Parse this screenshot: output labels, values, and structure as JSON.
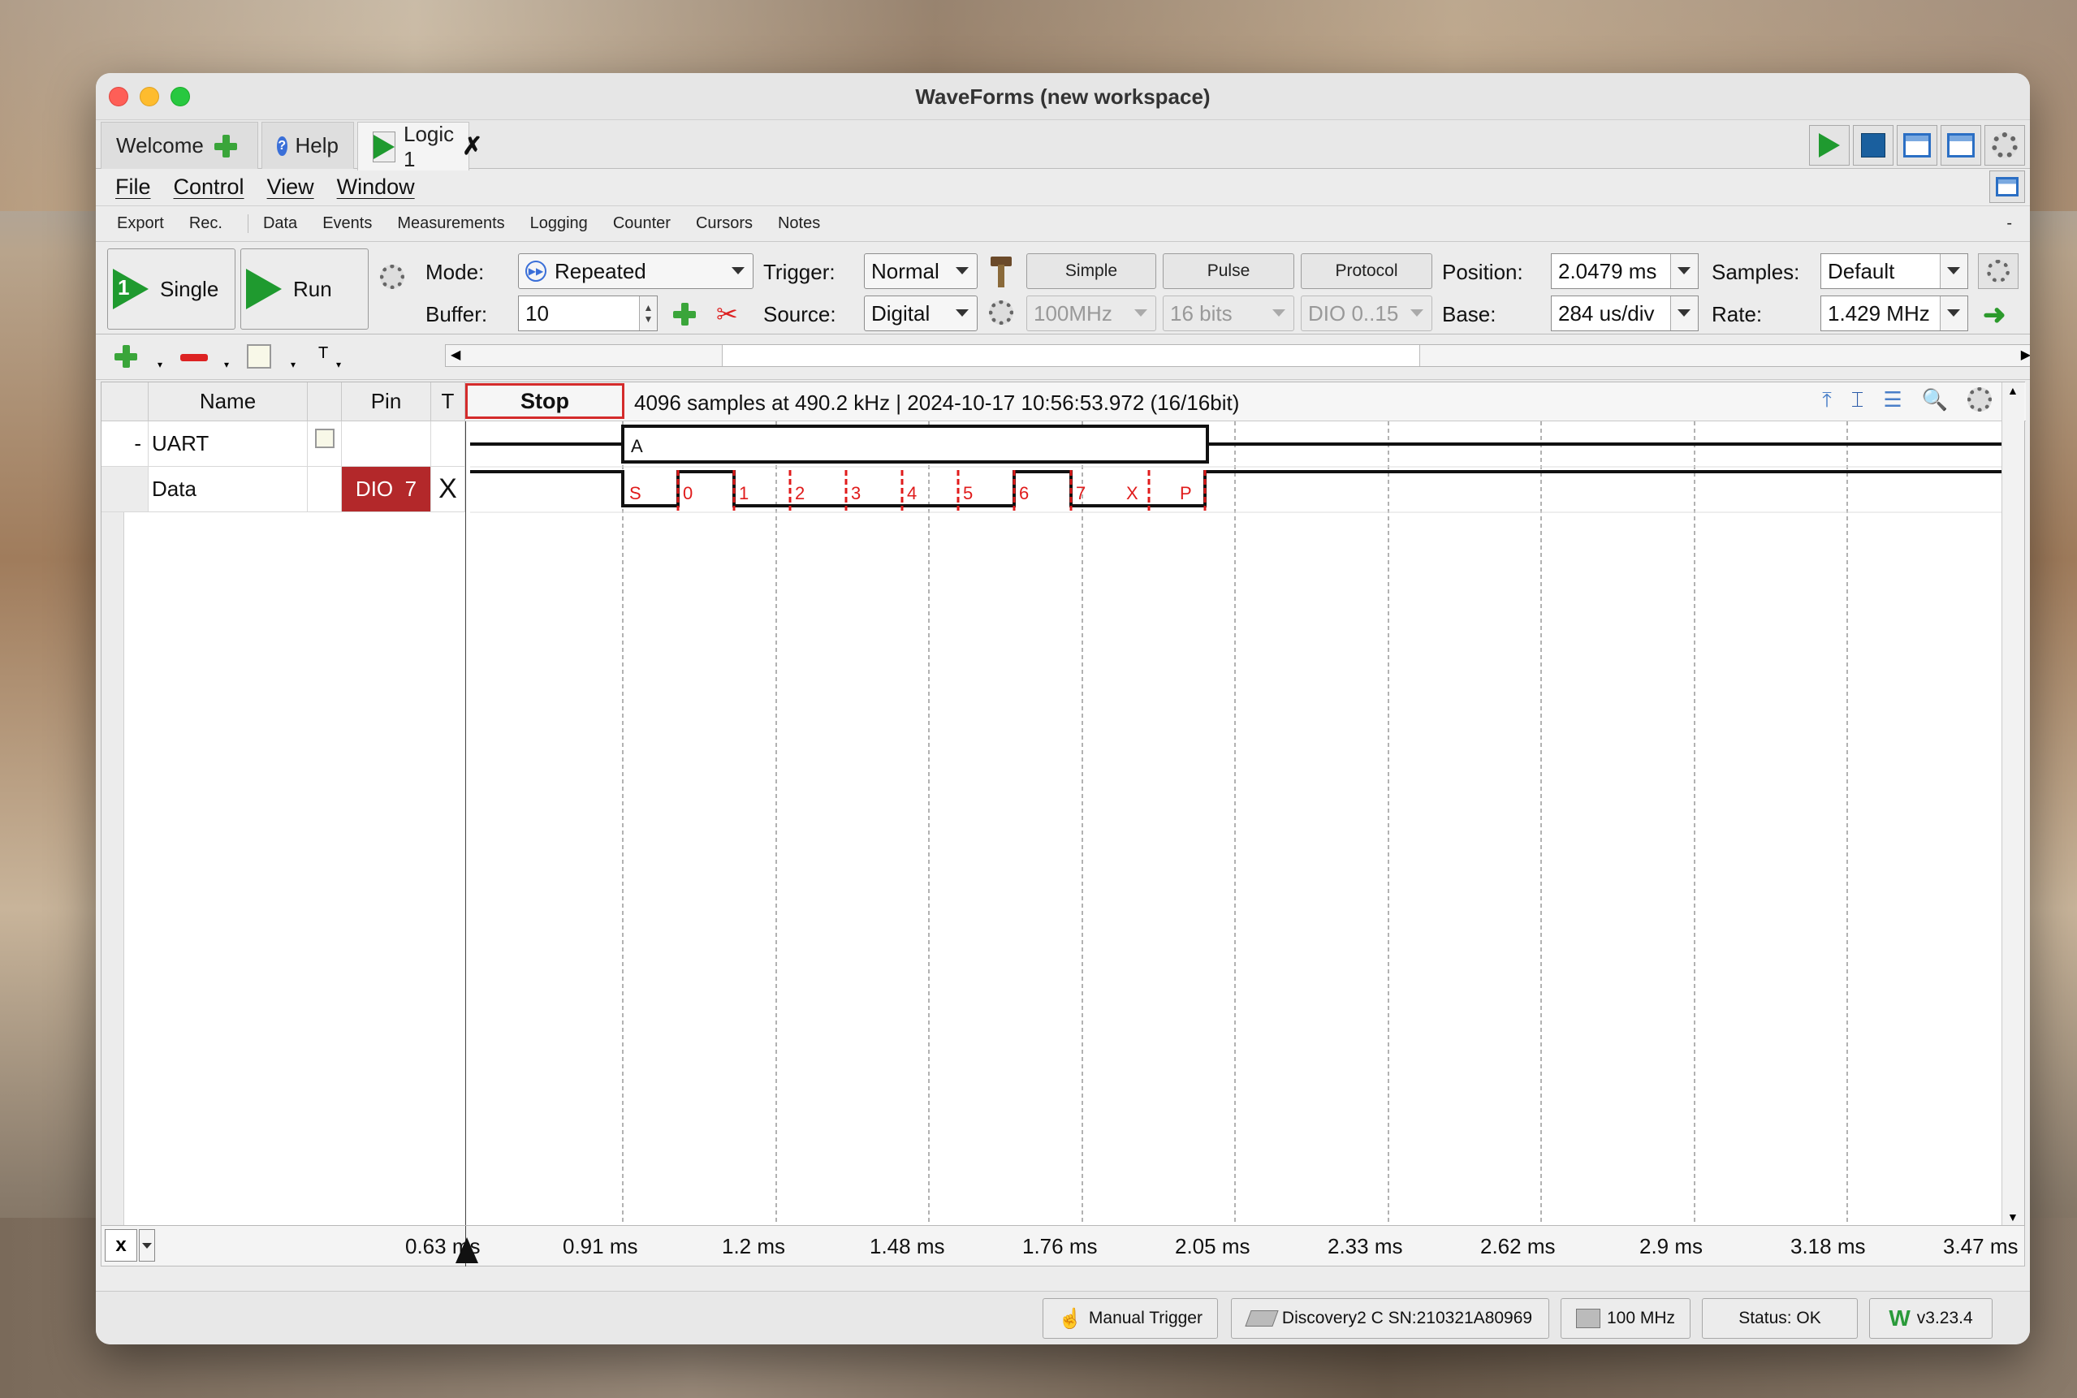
{
  "window": {
    "title": "WaveForms (new workspace)"
  },
  "tabs": [
    {
      "label": "Welcome"
    },
    {
      "label": "Help"
    },
    {
      "label": "Logic 1"
    }
  ],
  "menu": [
    "File",
    "Control",
    "View",
    "Window"
  ],
  "submenu": [
    "Export",
    "Rec.",
    "Data",
    "Events",
    "Measurements",
    "Logging",
    "Counter",
    "Cursors",
    "Notes"
  ],
  "submenu_collapse": "-",
  "controls": {
    "single_label": "Single",
    "single_num": "1",
    "run_label": "Run",
    "mode_label": "Mode:",
    "mode_value": "Repeated",
    "buffer_label": "Buffer:",
    "buffer_value": "10",
    "trigger_label": "Trigger:",
    "trigger_value": "Normal",
    "source_label": "Source:",
    "source_value": "Digital",
    "simple_label": "Simple",
    "pulse_label": "Pulse",
    "protocol_label": "Protocol",
    "freq_value": "100MHz",
    "bits_value": "16 bits",
    "dio_range_value": "DIO 0..15",
    "position_label": "Position:",
    "position_value": "2.0479 ms",
    "base_label": "Base:",
    "base_value": "284 us/div",
    "samples_label": "Samples:",
    "samples_value": "Default",
    "rate_label": "Rate:",
    "rate_value": "1.429 MHz"
  },
  "toolbar2": {
    "t_label": "T"
  },
  "table": {
    "headers": {
      "name": "Name",
      "pin": "Pin",
      "t": "T"
    },
    "stop_label": "Stop",
    "info": "4096 samples at 490.2 kHz | 2024-10-17 10:56:53.972 (16/16bit)",
    "rows": [
      {
        "expander": "-",
        "name": "UART",
        "pin": "",
        "t": ""
      },
      {
        "expander": "",
        "name": "Data",
        "pin": "DIO  7",
        "t": "X"
      }
    ]
  },
  "waveform": {
    "bus_value": "A",
    "bit_labels": [
      "S",
      "0",
      "1",
      "2",
      "3",
      "4",
      "5",
      "6",
      "7",
      "X",
      "P"
    ]
  },
  "time_axis": {
    "x_label": "x",
    "ticks": [
      "0.63 ms",
      "0.91 ms",
      "1.2 ms",
      "1.48 ms",
      "1.76 ms",
      "2.05 ms",
      "2.33 ms",
      "2.62 ms",
      "2.9 ms",
      "3.18 ms",
      "3.47 ms"
    ]
  },
  "status": {
    "manual_trigger": "Manual Trigger",
    "device": "Discovery2 C SN:210321A80969",
    "clock": "100 MHz",
    "status": "Status: OK",
    "version": "v3.23.4"
  },
  "colors": {
    "accent_green": "#1f9a2f",
    "trigger_red": "#d42b2b",
    "pin_red": "#b3282a",
    "stop_blue": "#1a5f9e"
  }
}
